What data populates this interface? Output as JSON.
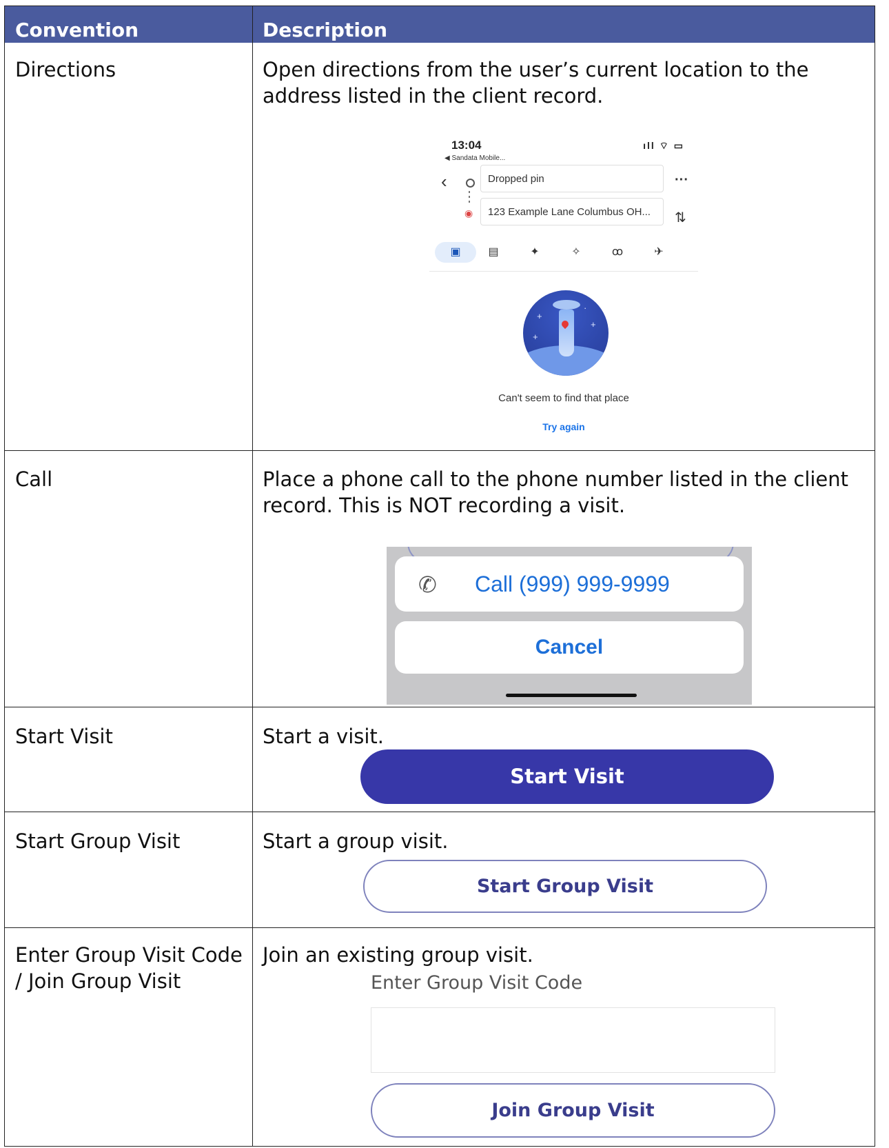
{
  "table": {
    "headers": {
      "convention": "Convention",
      "description": "Description"
    },
    "rows": [
      {
        "convention": "Directions",
        "description": "Open directions from the user’s current location to the address listed in the client record."
      },
      {
        "convention": "Call",
        "description": "Place a phone call to the phone number listed in the client record. This is NOT recording a visit."
      },
      {
        "convention": "Start Visit",
        "description": "Start a visit."
      },
      {
        "convention": "Start Group Visit",
        "description": "Start a group visit."
      },
      {
        "convention": "Enter Group Visit Code / Join Group Visit",
        "description": "Join an existing group visit."
      }
    ]
  },
  "directions_screenshot": {
    "time": "13:04",
    "back_app": "◀ Sandata Mobile...",
    "origin": "Dropped pin",
    "destination": "123 Example Lane Columbus OH...",
    "message": "Can't seem to find that place",
    "retry": "Try again"
  },
  "call_sheet": {
    "call_label": "Call (999) 999-9999",
    "cancel_label": "Cancel"
  },
  "buttons": {
    "start_visit": "Start Visit",
    "start_group_visit": "Start Group Visit",
    "enter_code_label": "Enter Group Visit Code",
    "join_group_visit": "Join Group Visit"
  }
}
